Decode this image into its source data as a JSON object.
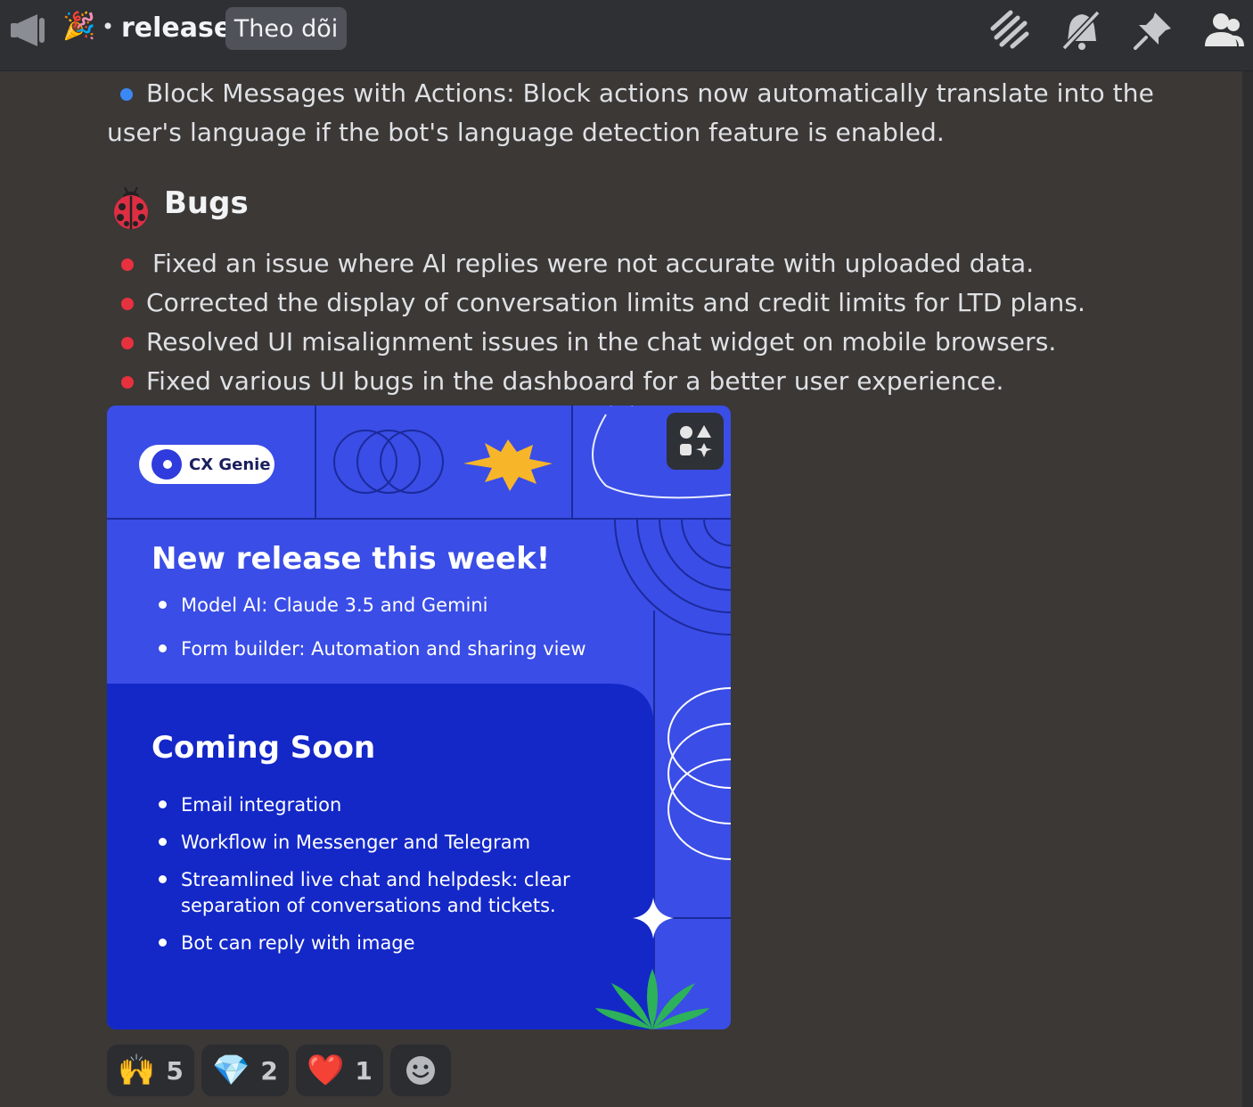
{
  "header": {
    "channel_icon": "announcement-megaphone-icon",
    "channel_emoji": "🎉",
    "separator": "•",
    "channel_name": "release",
    "follow_label": "Theo dõi",
    "icons": [
      "threads-icon",
      "mute-bell-icon",
      "pin-icon",
      "members-icon"
    ]
  },
  "message": {
    "top_item_line1": "Block Messages with Actions: Block actions now automatically translate into the",
    "top_item_line2": "user's language if the bot's language detection feature is enabled.",
    "bugs_title": "Bugs",
    "bugs_icon": "ladybug-icon",
    "bugs": [
      "Fixed an issue where AI replies were not accurate with uploaded data.",
      "Corrected the display of conversation limits and credit limits for LTD plans.",
      "Resolved UI misalignment issues in the chat widget on mobile browsers.",
      "Fixed various UI bugs in the dashboard for a better user experience."
    ]
  },
  "card": {
    "logo_text": "CX Genie",
    "heading1": "New release this week!",
    "new_items": [
      "Model AI: Claude 3.5 and Gemini",
      "Form builder: Automation and sharing view"
    ],
    "heading2": "Coming Soon",
    "soon_items": [
      "Email integration",
      "Workflow in Messenger and Telegram",
      "Streamlined live chat and helpdesk: clear",
      "Bot can reply with image"
    ],
    "soon_item3_line2": "separation of conversations and tickets.",
    "alt_button_icon": "image-alt-icon"
  },
  "reactions": [
    {
      "emoji": "🙌",
      "count": "5"
    },
    {
      "emoji": "💎",
      "count": "2"
    },
    {
      "emoji": "❤️",
      "count": "1"
    }
  ],
  "add_reaction_icon": "add-reaction-smile-icon",
  "colors": {
    "blue_bullet": "#3b88f5",
    "red_bullet": "#e8313e",
    "card_blue": "#3a4de6",
    "card_dark": "#1428c8"
  }
}
